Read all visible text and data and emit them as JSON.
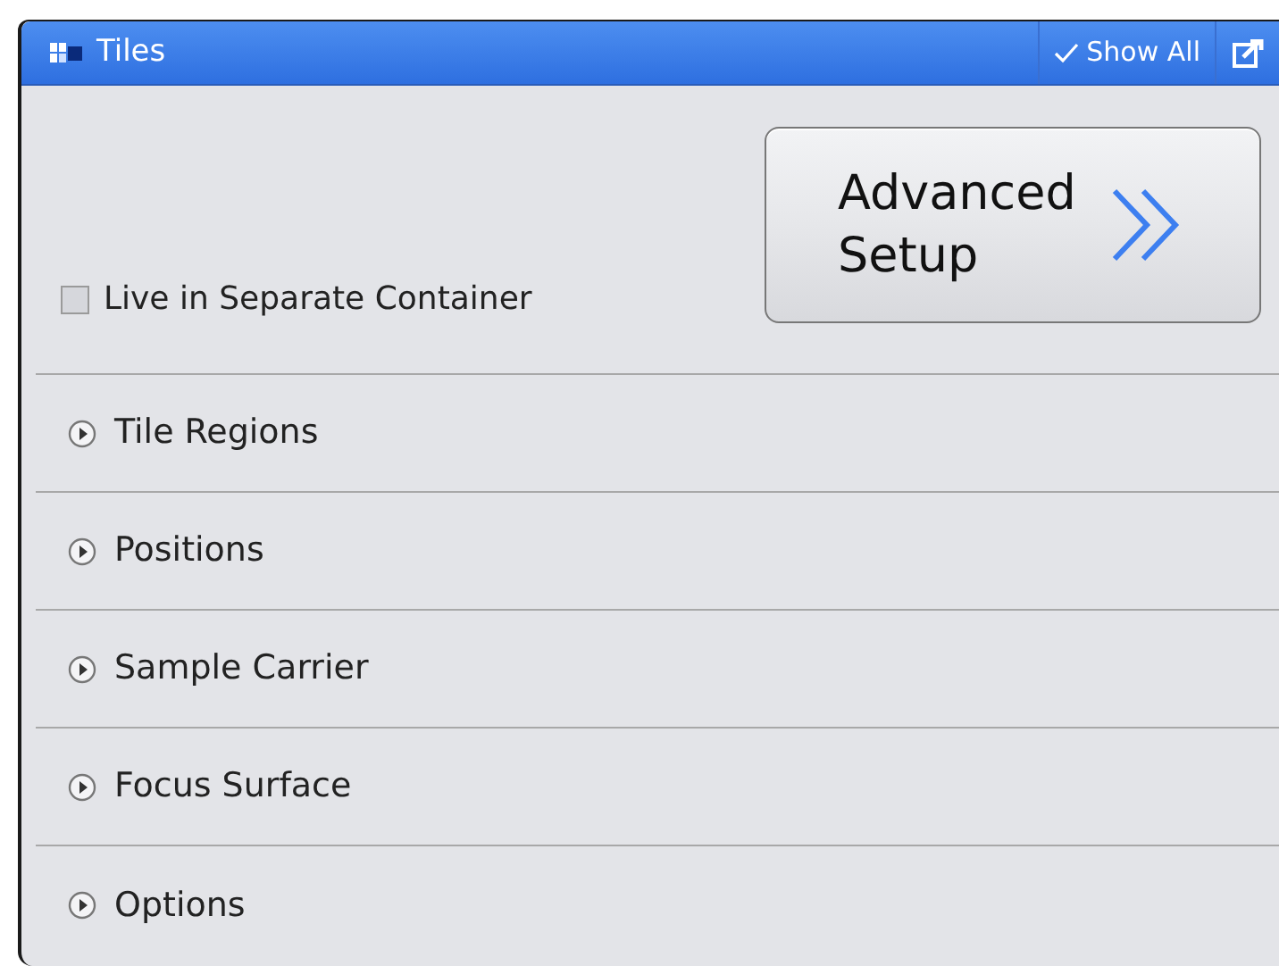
{
  "panel": {
    "title": "Tiles",
    "show_all": {
      "label": "Show All",
      "checked": true
    }
  },
  "advanced_setup": {
    "label_line_1": "Advanced",
    "label_line_2": "Setup"
  },
  "live_in_separate_container": {
    "label": "Live in Separate Container",
    "checked": false
  },
  "sections": [
    {
      "label": "Tile Regions",
      "expanded": false
    },
    {
      "label": "Positions",
      "expanded": false
    },
    {
      "label": "Sample Carrier",
      "expanded": false
    },
    {
      "label": "Focus Surface",
      "expanded": false
    },
    {
      "label": "Options",
      "expanded": false
    }
  ]
}
